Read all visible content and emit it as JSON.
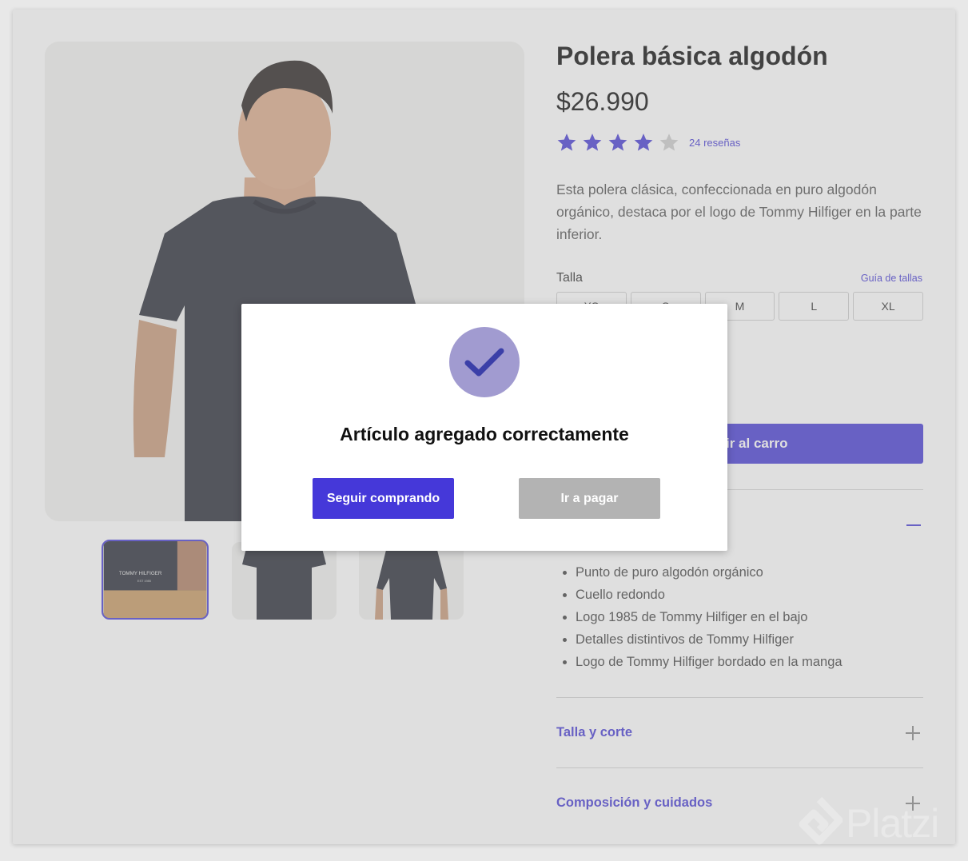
{
  "product": {
    "title": "Polera básica algodón",
    "price": "$26.990",
    "rating": {
      "value": 4,
      "max": 5,
      "reviews_label": "24 reseñas"
    },
    "description": "Esta polera clásica, confeccionada en puro algodón orgánico, destaca por el logo de Tommy Hilfiger en la parte inferior.",
    "size": {
      "label": "Talla",
      "guide_link": "Guía de tallas",
      "options": [
        "XS",
        "S",
        "M",
        "L",
        "XL"
      ]
    },
    "add_to_cart_label": "Añadir al carro",
    "features": [
      "Punto de puro algodón orgánico",
      "Cuello redondo",
      "Logo 1985 de Tommy Hilfiger en el bajo",
      "Detalles distintivos de Tommy Hilfiger",
      "Logo de Tommy Hilfiger bordado en la manga"
    ],
    "accordions": [
      {
        "title": "Talla y corte"
      },
      {
        "title": "Composición y cuidados"
      }
    ]
  },
  "thumbnail_logo": {
    "brand": "TOMMY HILFIGER",
    "since": "EST 1985"
  },
  "modal": {
    "title": "Artículo agregado correctamente",
    "continue_label": "Seguir comprando",
    "pay_label": "Ir a pagar"
  },
  "watermark": {
    "text": "Platzi"
  },
  "colors": {
    "accent": "#4a3fd6",
    "pay_button": "#b3b3b3",
    "check_circle": "#a19bd0",
    "star_empty": "#cfcfcf"
  }
}
